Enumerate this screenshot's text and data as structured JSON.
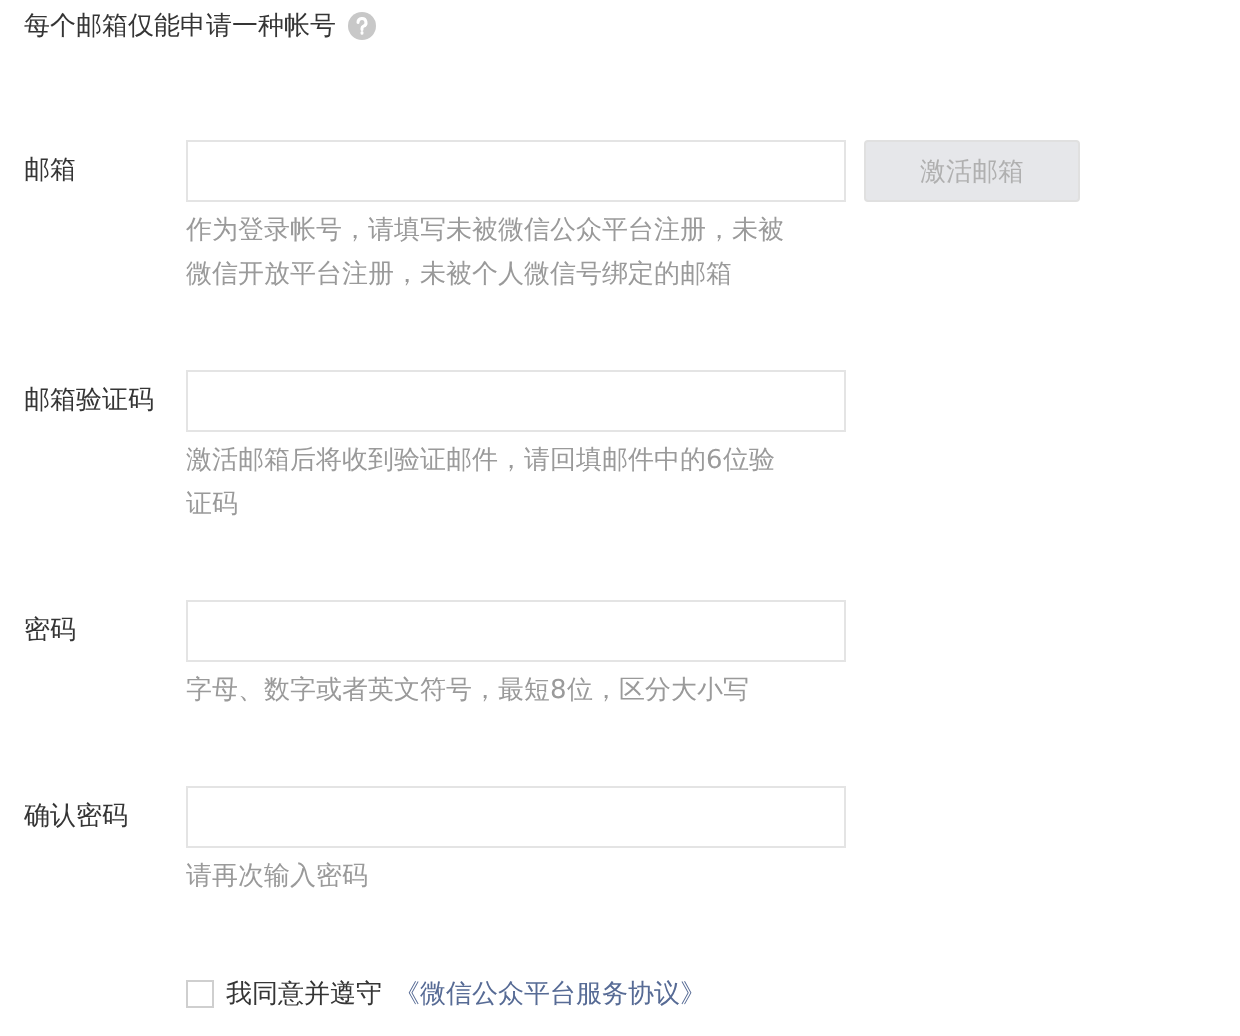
{
  "heading": {
    "text": "每个邮箱仅能申请一种帐号"
  },
  "fields": [
    {
      "label": "邮箱",
      "hint": "作为登录帐号，请填写未被微信公众平台注册，未被微信开放平台注册，未被个人微信号绑定的邮箱",
      "button": {
        "label": "激活邮箱",
        "disabled": true
      }
    },
    {
      "label": "邮箱验证码",
      "hint": "激活邮箱后将收到验证邮件，请回填邮件中的6位验证码"
    },
    {
      "label": "密码",
      "hint": "字母、数字或者英文符号，最短8位，区分大小写"
    },
    {
      "label": "确认密码",
      "hint": "请再次输入密码"
    }
  ],
  "agreement": {
    "checked": false,
    "text": "我同意并遵守",
    "link": "《微信公众平台服务协议》"
  }
}
